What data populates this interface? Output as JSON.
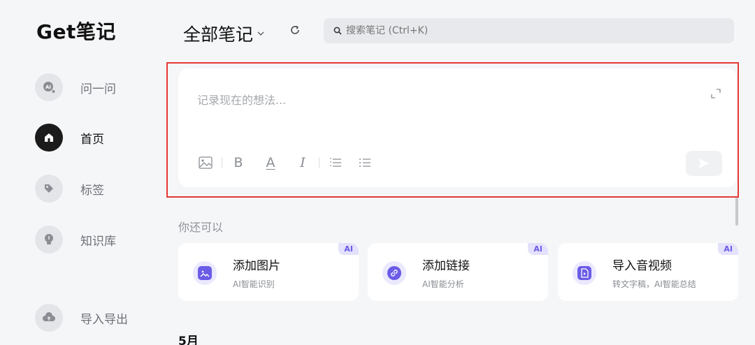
{
  "app": {
    "logo": "Get笔记"
  },
  "sidebar": {
    "items": [
      {
        "label": "问一问",
        "icon": "ai-icon"
      },
      {
        "label": "首页",
        "icon": "home-icon",
        "active": true
      },
      {
        "label": "标签",
        "icon": "tag-icon"
      },
      {
        "label": "知识库",
        "icon": "lightbulb-icon"
      },
      {
        "label": "导入导出",
        "icon": "cloud-upload-icon"
      }
    ]
  },
  "header": {
    "title": "全部笔记",
    "search_placeholder": "搜索笔记 (Ctrl+K)"
  },
  "editor": {
    "placeholder": "记录现在的想法...",
    "tools": [
      "image-icon",
      "bold-icon",
      "text-color-icon",
      "italic-icon",
      "ordered-list-icon",
      "bullet-list-icon"
    ],
    "tool_glyphs": {
      "bold": "B",
      "text_color": "A",
      "italic": "I"
    }
  },
  "more": {
    "label": "你还可以",
    "cards": [
      {
        "title": "添加图片",
        "subtitle": "AI智能识别",
        "badge": "AI",
        "icon": "image-icon"
      },
      {
        "title": "添加链接",
        "subtitle": "AI智能分析",
        "badge": "AI",
        "icon": "link-icon"
      },
      {
        "title": "导入音视频",
        "subtitle": "转文字稿，AI智能总结",
        "badge": "AI",
        "icon": "media-file-icon"
      }
    ]
  },
  "timeline": {
    "month": "5月"
  },
  "colors": {
    "accent": "#6b5ce6",
    "highlight_border": "#e53935",
    "active_nav": "#1b1b1b"
  }
}
